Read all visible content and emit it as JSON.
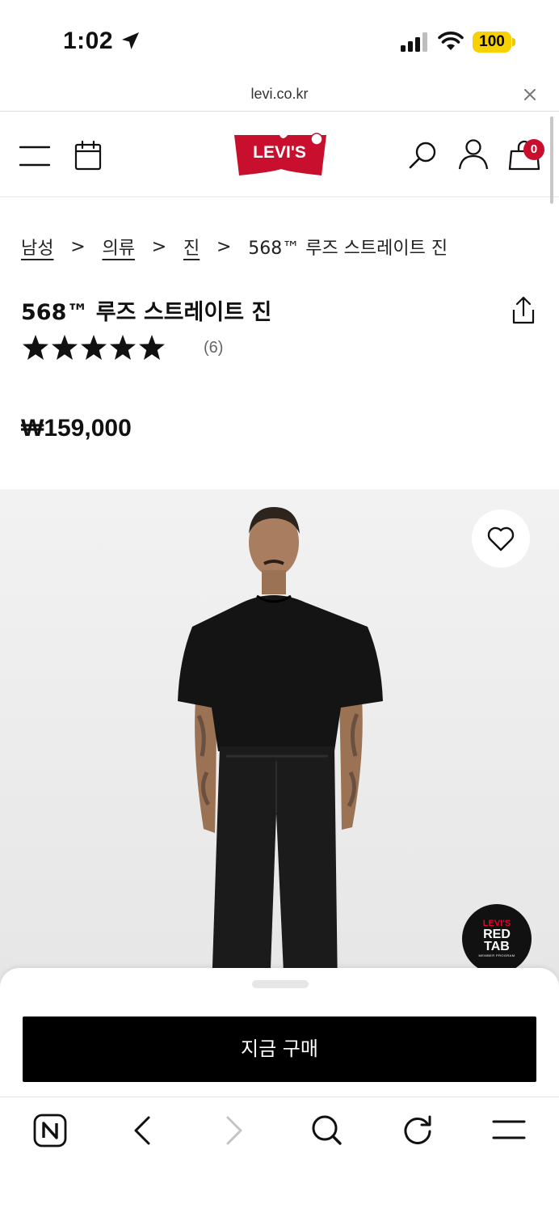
{
  "status_bar": {
    "time": "1:02",
    "battery": "100",
    "icons": [
      "location-arrow-icon",
      "cellular-signal-icon",
      "wifi-icon",
      "battery-icon"
    ]
  },
  "url_bar": {
    "domain": "levi.co.kr",
    "close_icon": "close-icon"
  },
  "header": {
    "logo_text": "LEVI'S",
    "icons": [
      "menu-icon",
      "calendar-icon",
      "search-icon",
      "account-icon",
      "shopping-bag-icon"
    ],
    "cart_count": "0",
    "brand_color": "#c8102e"
  },
  "breadcrumb": {
    "items": [
      "남성",
      "의류",
      "진"
    ],
    "current": "568™ 루즈 스트레이트 진",
    "separator": ">"
  },
  "product": {
    "title": "568™ 루즈 스트레이트 진",
    "rating": 5,
    "rating_max": 5,
    "review_count": "(6)",
    "price": "₩159,000"
  },
  "image": {
    "wishlist_icon": "heart-icon",
    "badge": {
      "brand": "LEVI'S",
      "line1": "RED",
      "line2": "TAB",
      "line3": "MEMBER PROGRAM"
    }
  },
  "purchase": {
    "buy_label": "지금 구매"
  },
  "toolbar": {
    "icons": [
      "naver-home-icon",
      "back-icon",
      "forward-icon",
      "search-icon",
      "reload-icon",
      "menu-icon"
    ]
  }
}
